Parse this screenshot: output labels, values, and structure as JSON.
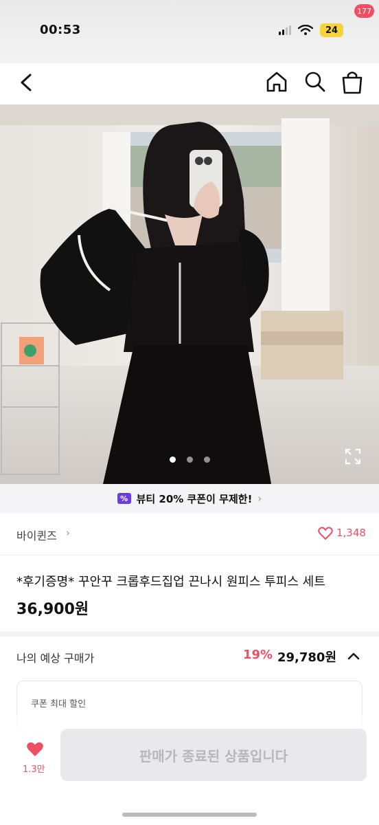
{
  "status_bar": {
    "time": "00:53",
    "battery": "24",
    "icons": [
      "signal-icon",
      "wifi-icon",
      "battery-icon"
    ]
  },
  "nav": {
    "icons": [
      "back-icon",
      "home-icon",
      "search-icon",
      "cart-icon"
    ],
    "cart_badge": "177"
  },
  "gallery": {
    "total_images": 3,
    "active_index": 0,
    "expand_icon": "expand-icon"
  },
  "coupon_banner": {
    "icon_symbol": "%",
    "text": "뷰티 20% 쿠폰이 무제한!",
    "arrow": "›"
  },
  "brand": {
    "name": "바이퀸즈",
    "arrow": "›",
    "like_count": "1,348"
  },
  "product": {
    "title": "*후기증명* 꾸안꾸 크롭후드집업 끈나시 원피스 투피스 세트",
    "price": "36,900원"
  },
  "estimate": {
    "label": "나의 예상 구매가",
    "discount": "19%",
    "price": "29,780원"
  },
  "coupon_box": {
    "label": "쿠폰 최대 할인"
  },
  "bottom_bar": {
    "wish_count": "1.3만",
    "cta_label": "판매가 종료된 상품입니다"
  },
  "colors": {
    "accent": "#ef4f64",
    "coupon_purple": "#6c3ce2",
    "disabled_bg": "#e9e9eb",
    "disabled_text": "#b7b7bb"
  }
}
